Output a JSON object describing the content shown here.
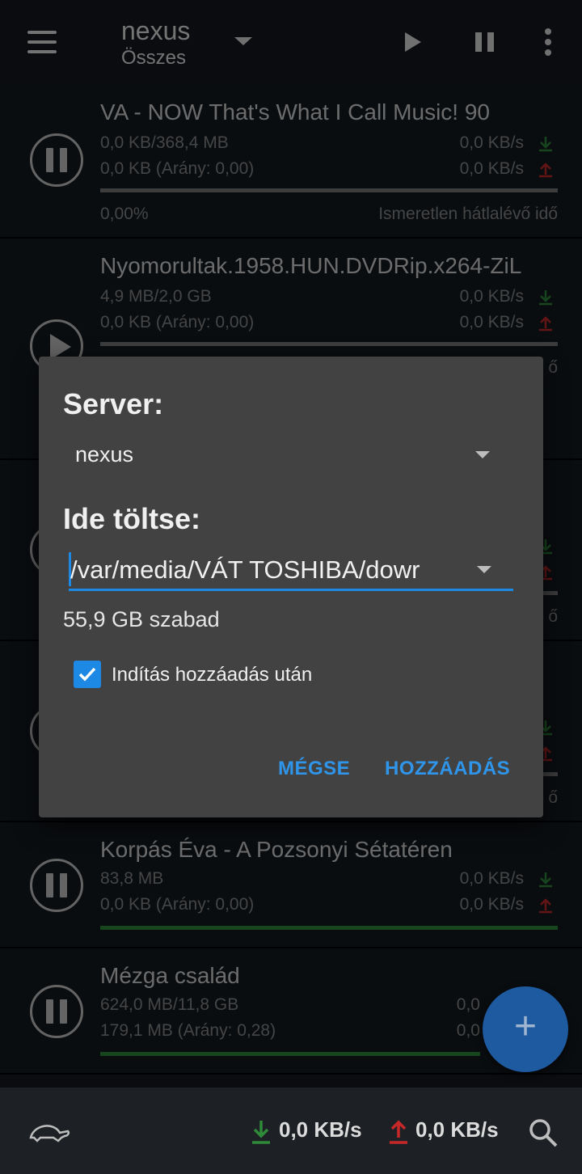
{
  "colors": {
    "background": "#15191e",
    "dialog": "#424242",
    "accent": "#1e88e5",
    "download": "#2e8b3a",
    "upload": "#c62828"
  },
  "header": {
    "server_name": "nexus",
    "filter": "Összes",
    "icons": [
      "menu-icon",
      "chevron-down-icon",
      "play-icon",
      "pause-icon",
      "overflow-menu-icon"
    ]
  },
  "torrents": [
    {
      "title": "VA - NOW That's What I Call Music! 90",
      "size": "0,0 KB/368,4 MB",
      "uploaded": "0,0 KB (Arány: 0,00)",
      "down_speed": "0,0 KB/s",
      "up_speed": "0,0 KB/s",
      "progress_text": "0,00%",
      "eta": "Ismeretlen hátlalévő idő",
      "state_icon": "pause-icon",
      "progress": 0
    },
    {
      "title": "Nyomorultak.1958.HUN.DVDRip.x264-ZiL",
      "size": "4,9 MB/2,0 GB",
      "uploaded": "0,0 KB (Arány: 0,00)",
      "down_speed": "0,0 KB/s",
      "up_speed": "0,0 KB/s",
      "progress_text": "",
      "eta": "ő",
      "state_icon": "play-icon",
      "progress": 0
    },
    {
      "title": "",
      "size": "",
      "uploaded": "",
      "down_speed": "",
      "up_speed": "",
      "progress_text": "",
      "eta": "ő",
      "state_icon": "pause-icon",
      "progress": 0
    },
    {
      "title": "",
      "size": "",
      "uploaded": "",
      "down_speed": "",
      "up_speed": "",
      "progress_text": "",
      "eta": "ő",
      "state_icon": "pause-icon",
      "progress": 0
    },
    {
      "title": "Korpás Éva - A Pozsonyi Sétatéren",
      "size": "83,8 MB",
      "uploaded": "0,0 KB (Arány: 0,00)",
      "down_speed": "0,0 KB/s",
      "up_speed": "0,0 KB/s",
      "progress_text": "",
      "eta": "",
      "state_icon": "pause-icon",
      "progress": 1
    },
    {
      "title": "Mézga család",
      "size": "624,0 MB/11,8 GB",
      "uploaded": "179,1 MB (Arány: 0,28)",
      "down_speed": "0,0",
      "up_speed": "0,0",
      "progress_text": "",
      "eta": "",
      "state_icon": "pause-icon",
      "progress": 1
    }
  ],
  "dialog": {
    "server_label": "Server:",
    "server_value": "nexus",
    "path_label": "Ide töltse:",
    "path_value": "/var/media/VÁT TOSHIBA/dowr",
    "free_space": "55,9 GB szabad",
    "start_after_add_label": "Indítás hozzáadás után",
    "start_after_add_checked": true,
    "cancel_label": "MÉGSE",
    "add_label": "HOZZÁADÁS"
  },
  "fab": {
    "label": "+"
  },
  "footer": {
    "down_speed": "0,0 KB/s",
    "up_speed": "0,0 KB/s",
    "icons": [
      "turtle-icon",
      "download-arrow-icon",
      "upload-arrow-icon",
      "search-icon"
    ]
  }
}
